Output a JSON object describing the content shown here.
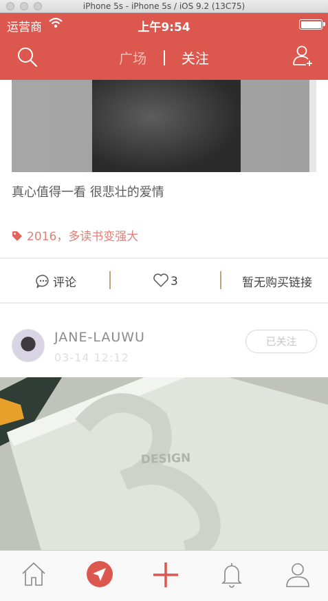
{
  "simulator": {
    "title": "iPhone 5s - iPhone 5s / iOS 9.2 (13C75)"
  },
  "status_bar": {
    "carrier": "运营商",
    "time": "上午9:54"
  },
  "nav": {
    "tabs": [
      {
        "label": "广场",
        "active": false
      },
      {
        "label": "关注",
        "active": true
      }
    ],
    "left_icon": "search-icon",
    "right_icon": "add-user-icon"
  },
  "post": {
    "title": "真心值得一看 很悲壮的爱情",
    "tag": "2016，多读书变强大",
    "actions": {
      "comment_label": "评论",
      "like_count": "3",
      "buy_label": "暂无购买链接"
    }
  },
  "next_post": {
    "author_name": "JANE-LAUWU",
    "time": "03-14 12:12",
    "follow_label": "已关注",
    "image_text": "DESIGN"
  },
  "tabbar": {
    "items": [
      "home-icon",
      "send-icon",
      "plus-icon",
      "bell-icon",
      "profile-icon"
    ]
  },
  "colors": {
    "accent": "#dc574d",
    "tag": "#e07f77"
  }
}
